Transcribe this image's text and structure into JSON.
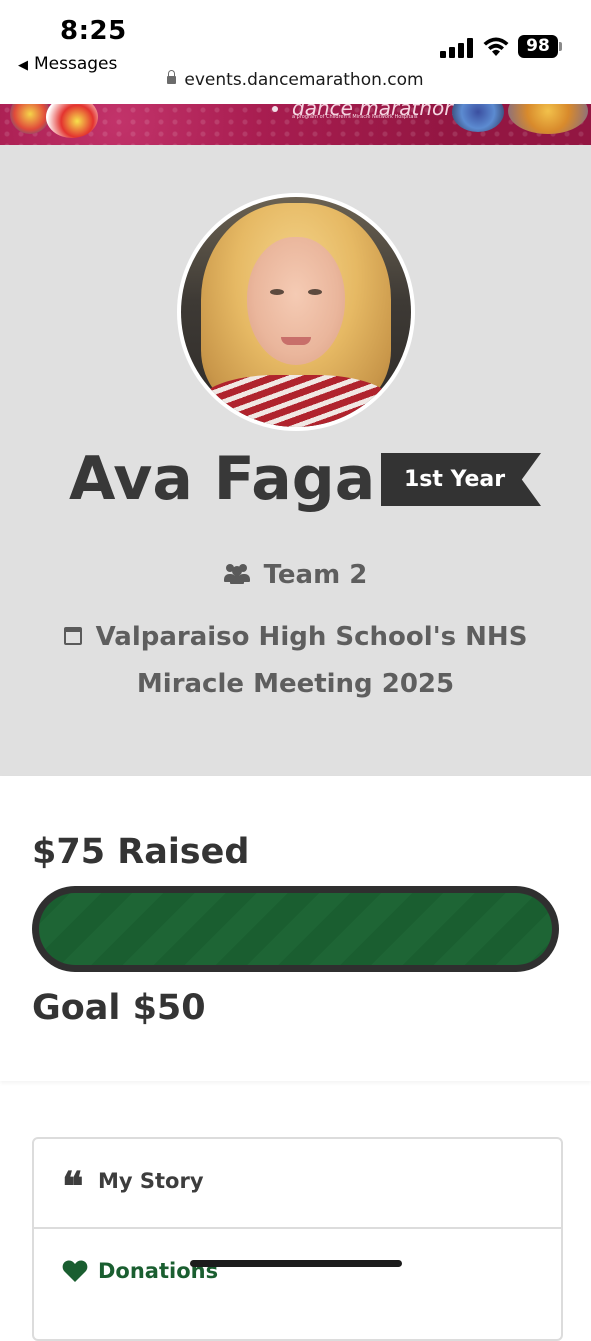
{
  "status_bar": {
    "time": "8:25",
    "back_label": "Messages",
    "battery": "98"
  },
  "browser": {
    "url": "events.dancemarathon.com"
  },
  "banner": {
    "logo_text": "dance marathon",
    "logo_sub": "a program of Children's Miracle Network Hospitals"
  },
  "profile": {
    "name": "Ava Faga",
    "badge": "1st Year",
    "team": "Team 2",
    "event": "Valparaiso High School's NHS Miracle Meeting 2025"
  },
  "fundraising": {
    "raised_label": "$75 Raised",
    "goal_label": "Goal $50",
    "progress_fraction": 1.0
  },
  "tabs": {
    "story_label": "My Story",
    "donations_label": "Donations"
  },
  "colors": {
    "brand_green": "#1a5e30",
    "banner_pink": "#a81d50",
    "badge_dark": "#333333"
  },
  "icons": [
    "back-triangle-icon",
    "signal-icon",
    "wifi-icon",
    "battery-icon",
    "lock-icon",
    "team-icon",
    "calendar-icon",
    "quote-icon",
    "heart-icon"
  ]
}
